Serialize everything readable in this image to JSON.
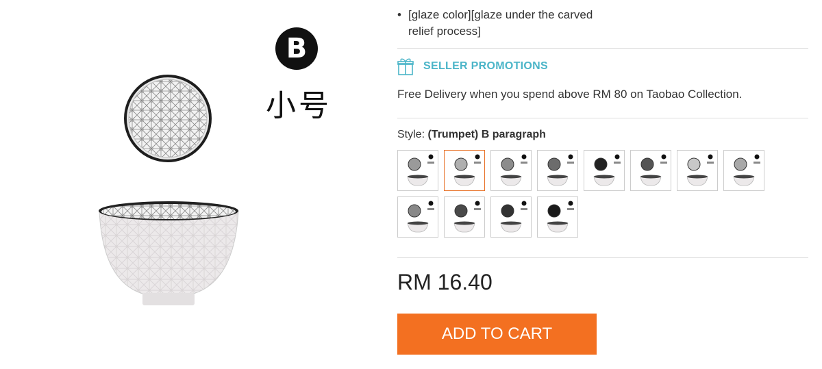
{
  "product_image": {
    "badge_letter": "B",
    "size_label": "小号"
  },
  "description": {
    "bullet_text": "[glaze color][glaze under the carved relief process]"
  },
  "promotions": {
    "icon": "gift-icon",
    "title": "SELLER PROMOTIONS",
    "text": "Free Delivery when you spend above RM 80 on Taobao Collection."
  },
  "style": {
    "label": "Style:",
    "selected_value": "(Trumpet) B paragraph",
    "selected_index": 1,
    "swatch_count": 12
  },
  "price": "RM 16.40",
  "add_to_cart_label": "ADD TO CART",
  "colors": {
    "accent": "#f37021",
    "promo": "#4bb5c8",
    "selected_border": "#e8732a"
  }
}
